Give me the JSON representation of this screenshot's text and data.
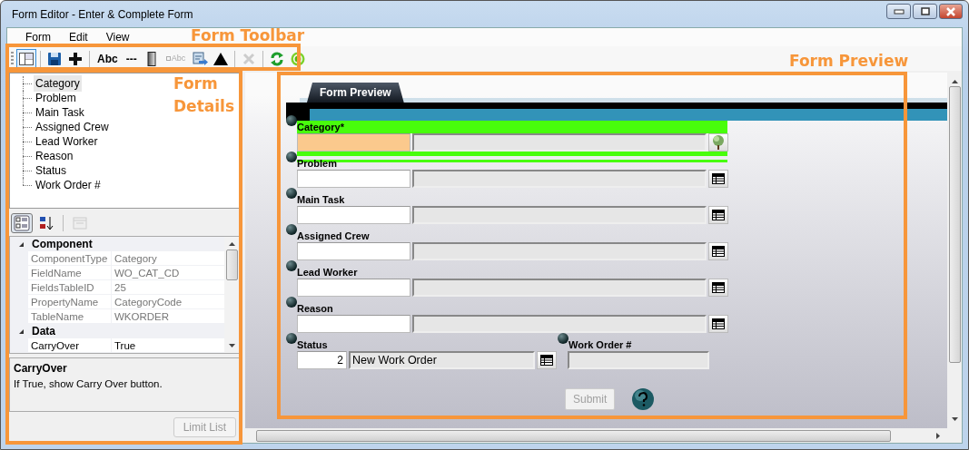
{
  "window": {
    "title": "Form Editor - Enter & Complete Form"
  },
  "menu": [
    {
      "label": "Form"
    },
    {
      "label": "Edit"
    },
    {
      "label": "View"
    }
  ],
  "toolbar": [
    {
      "kind": "grip"
    },
    {
      "kind": "icon",
      "selected": true,
      "disabled": false
    },
    {
      "kind": "separator"
    },
    {
      "kind": "icon",
      "selected": false,
      "disabled": false
    },
    {
      "kind": "icon",
      "selected": false,
      "disabled": false
    },
    {
      "kind": "separator"
    },
    {
      "kind": "text",
      "label": "Abc",
      "selected": false,
      "disabled": false
    },
    {
      "kind": "text",
      "label": "---",
      "selected": false,
      "disabled": false
    },
    {
      "kind": "icon",
      "selected": false,
      "disabled": false
    },
    {
      "kind": "boxed_text",
      "label": "Abc",
      "selected": false,
      "disabled": true
    },
    {
      "kind": "icon",
      "selected": false,
      "disabled": false
    },
    {
      "kind": "icon",
      "selected": false,
      "disabled": false
    },
    {
      "kind": "separator"
    },
    {
      "kind": "icon",
      "selected": false,
      "disabled": true
    },
    {
      "kind": "separator"
    },
    {
      "kind": "icon",
      "selected": false,
      "disabled": false
    },
    {
      "kind": "icon",
      "selected": false,
      "disabled": false
    }
  ],
  "tree": {
    "items": [
      {
        "label": "Category",
        "selected": true
      },
      {
        "label": "Problem",
        "selected": false
      },
      {
        "label": "Main Task",
        "selected": false
      },
      {
        "label": "Assigned Crew",
        "selected": false
      },
      {
        "label": "Lead Worker",
        "selected": false
      },
      {
        "label": "Reason",
        "selected": false
      },
      {
        "label": "Status",
        "selected": false
      },
      {
        "label": "Work Order #",
        "selected": false
      }
    ]
  },
  "property_toolbar": [
    {
      "selected": true,
      "disabled": false
    },
    {
      "selected": false,
      "disabled": false
    },
    {
      "selected": false,
      "disabled": true
    }
  ],
  "property_grid": {
    "sections": [
      {
        "name": "Component",
        "expanded": true,
        "rows": [
          {
            "name": "ComponentType",
            "value": "Category",
            "readonly": true
          },
          {
            "name": "FieldName",
            "value": "WO_CAT_CD",
            "readonly": true
          },
          {
            "name": "FieldsTableID",
            "value": "25",
            "readonly": true
          },
          {
            "name": "PropertyName",
            "value": "CategoryCode",
            "readonly": true
          },
          {
            "name": "TableName",
            "value": "WKORDER",
            "readonly": true
          }
        ]
      },
      {
        "name": "Data",
        "expanded": true,
        "rows": [
          {
            "name": "CarryOver",
            "value": "True",
            "readonly": false
          }
        ]
      }
    ]
  },
  "description": {
    "title": "CarryOver",
    "text": "If True, show Carry Over button."
  },
  "limit_list_button": {
    "label": "Limit List",
    "disabled": true
  },
  "preview": {
    "tab": "Form Preview",
    "rows": [
      [
        {
          "kind": "tree_lookup",
          "label": "Category*",
          "selected": true,
          "required": true
        }
      ],
      [
        {
          "kind": "grid_lookup",
          "label": "Problem",
          "selected": false,
          "required": false
        }
      ],
      [
        {
          "kind": "grid_lookup",
          "label": "Main Task",
          "selected": false,
          "required": false
        }
      ],
      [
        {
          "kind": "grid_lookup",
          "label": "Assigned Crew",
          "selected": false,
          "required": false
        }
      ],
      [
        {
          "kind": "grid_lookup",
          "label": "Lead Worker",
          "selected": false,
          "required": false
        }
      ],
      [
        {
          "kind": "grid_lookup",
          "label": "Reason",
          "selected": false,
          "required": false
        }
      ],
      [
        {
          "kind": "grid_lookup",
          "label": "Status",
          "code": "2",
          "description": "New Work Order",
          "selected": false,
          "required": false
        },
        {
          "kind": "text",
          "label": "Work Order #",
          "selected": false,
          "required": false
        }
      ]
    ],
    "submit": {
      "label": "Submit",
      "disabled": true
    }
  },
  "annotations": [
    {
      "text": "Form Toolbar"
    },
    {
      "text": "Form Details"
    },
    {
      "text": "Form Preview"
    }
  ]
}
